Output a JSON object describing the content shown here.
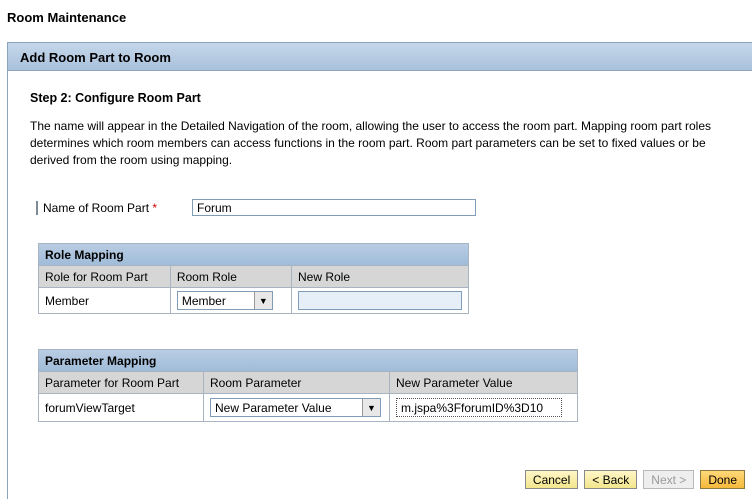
{
  "app": {
    "title": "Room Maintenance"
  },
  "panel": {
    "title": "Add Room Part to Room"
  },
  "step": {
    "title": "Step 2: Configure Room Part",
    "description": "The name will appear in the Detailed Navigation of the room, allowing the user to access the room part. Mapping room part roles determines which room members can access functions in the room part. Room part parameters can be set to fixed values or be derived from the room using mapping."
  },
  "name_field": {
    "label": "Name of Room Part",
    "required_marker": "*",
    "value": "Forum"
  },
  "role_mapping": {
    "title": "Role Mapping",
    "headers": [
      "Role for Room Part",
      "Room Role",
      "New Role"
    ],
    "rows": [
      {
        "role": "Member",
        "room_role": "Member",
        "new_role": ""
      }
    ]
  },
  "parameter_mapping": {
    "title": "Parameter Mapping",
    "headers": [
      "Parameter for Room Part",
      "Room Parameter",
      "New Parameter Value"
    ],
    "rows": [
      {
        "parameter": "forumViewTarget",
        "room_parameter": "New Parameter Value",
        "new_value": "m.jspa%3FforumID%3D10"
      }
    ]
  },
  "buttons": {
    "cancel": "Cancel",
    "back": "< Back",
    "next": "Next >",
    "done": "Done"
  }
}
